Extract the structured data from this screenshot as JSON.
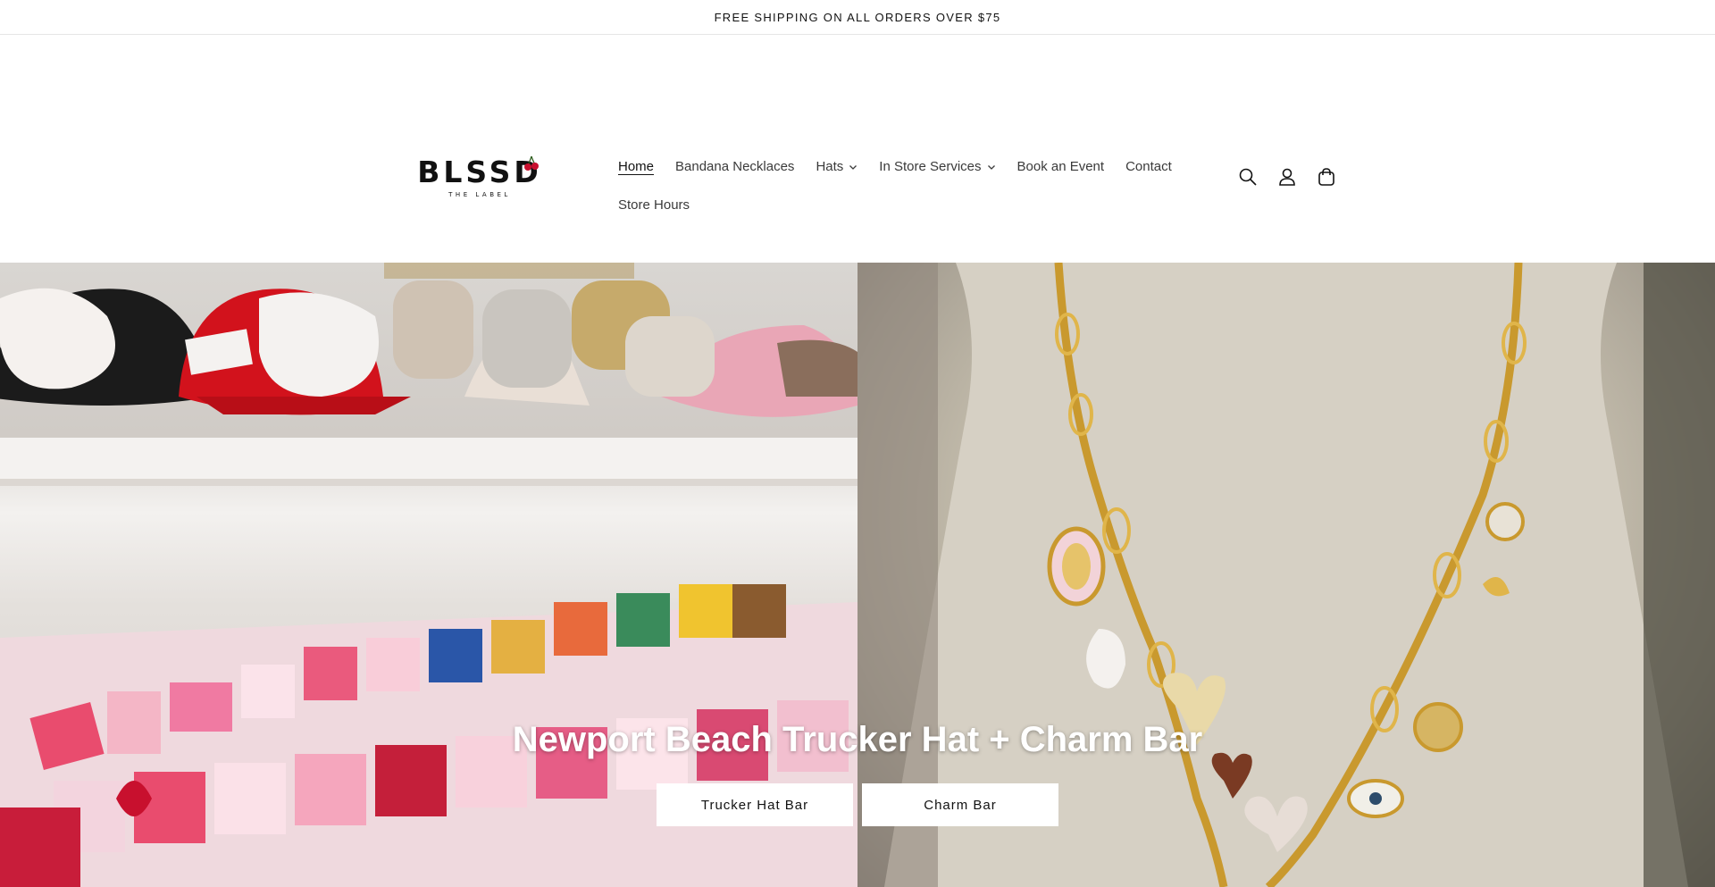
{
  "announcement": "FREE SHIPPING ON ALL ORDERS OVER $75",
  "logo": {
    "main": "BLSSD",
    "sub": "THE LABEL"
  },
  "nav": {
    "items": [
      {
        "label": "Home",
        "active": true,
        "dropdown": false
      },
      {
        "label": "Bandana Necklaces",
        "active": false,
        "dropdown": false
      },
      {
        "label": "Hats",
        "active": false,
        "dropdown": true
      },
      {
        "label": "In Store Services",
        "active": false,
        "dropdown": true
      },
      {
        "label": "Book an Event",
        "active": false,
        "dropdown": false
      },
      {
        "label": "Contact",
        "active": false,
        "dropdown": false
      },
      {
        "label": "Store Hours",
        "active": false,
        "dropdown": false
      }
    ]
  },
  "header_icons": [
    "search-icon",
    "account-icon",
    "cart-icon"
  ],
  "hero": {
    "title": "Newport Beach Trucker Hat + Charm Bar",
    "buttons": [
      "Trucker Hat Bar",
      "Charm Bar"
    ]
  },
  "colors": {
    "text": "#121212",
    "cherry": "#c8102e",
    "gold": "#c9a24a"
  }
}
